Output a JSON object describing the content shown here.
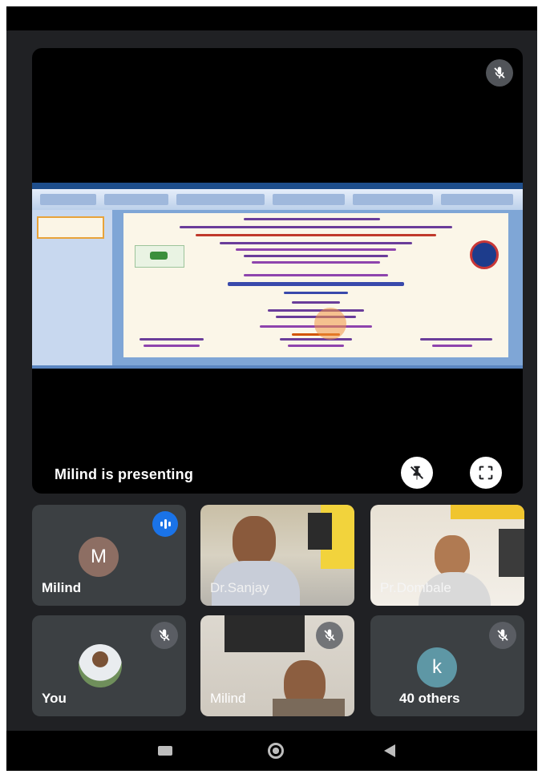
{
  "presentation": {
    "presenting_label": "Milind is presenting"
  },
  "tiles": [
    {
      "name": "Milind",
      "avatar_letter": "M",
      "avatar_color": "#8d6e63",
      "speaking": true,
      "video": false
    },
    {
      "name": "Dr.Sanjay",
      "speaking": false,
      "video": true
    },
    {
      "name": "Pr.Dombale",
      "speaking": false,
      "video": true
    },
    {
      "name": "You",
      "muted": true,
      "video": false
    },
    {
      "name": "Milind",
      "muted": true,
      "video": true
    },
    {
      "name": "40 others",
      "avatar_letter": "k",
      "avatar_color": "#5e97a5",
      "muted": true,
      "video": false
    }
  ],
  "colors": {
    "background": "#202124",
    "tile": "#3c4043",
    "accent": "#1a73e8"
  },
  "icons": {
    "tile_mic": "mic-off-icon",
    "pin": "pin-off-icon",
    "fullscreen": "fullscreen-icon",
    "speaking": "audio-level-icon",
    "nav": [
      "recents-icon",
      "home-icon",
      "back-icon"
    ]
  }
}
